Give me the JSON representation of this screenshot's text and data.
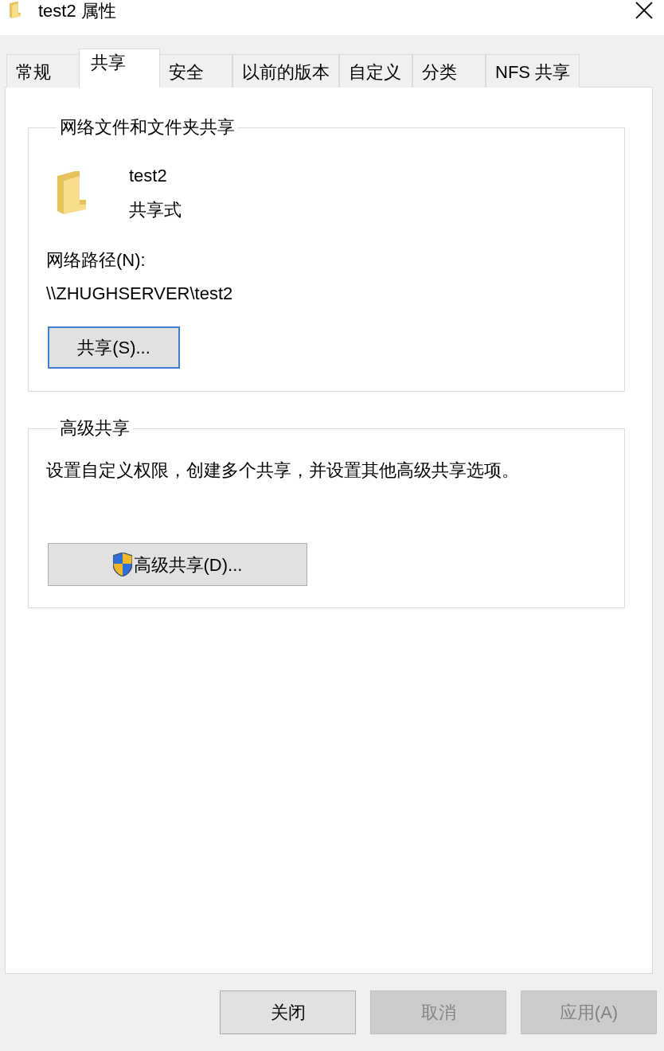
{
  "window": {
    "title": "test2 属性"
  },
  "tabs": [
    {
      "label": "常规",
      "selected": false
    },
    {
      "label": "共享",
      "selected": true
    },
    {
      "label": "安全",
      "selected": false
    },
    {
      "label": "以前的版本",
      "selected": false
    },
    {
      "label": "自定义",
      "selected": false
    },
    {
      "label": "分类",
      "selected": false
    },
    {
      "label": "NFS 共享",
      "selected": false
    }
  ],
  "network_sharing": {
    "legend": "网络文件和文件夹共享",
    "folder_name": "test2",
    "status": "共享式",
    "path_label": "网络路径(N):",
    "path": "\\\\ZHUGHSERVER\\test2",
    "share_button": {
      "label": "共享(S)...",
      "focused": true
    }
  },
  "advanced_sharing": {
    "legend": "高级共享",
    "description": "设置自定义权限，创建多个共享，并设置其他高级共享选项。",
    "button": {
      "label": "高级共享(D)...",
      "focused": false
    }
  },
  "buttons": [
    {
      "label": "关闭",
      "disabled": false
    },
    {
      "label": "取消",
      "disabled": true
    },
    {
      "label": "应用(A)",
      "disabled": true
    }
  ]
}
